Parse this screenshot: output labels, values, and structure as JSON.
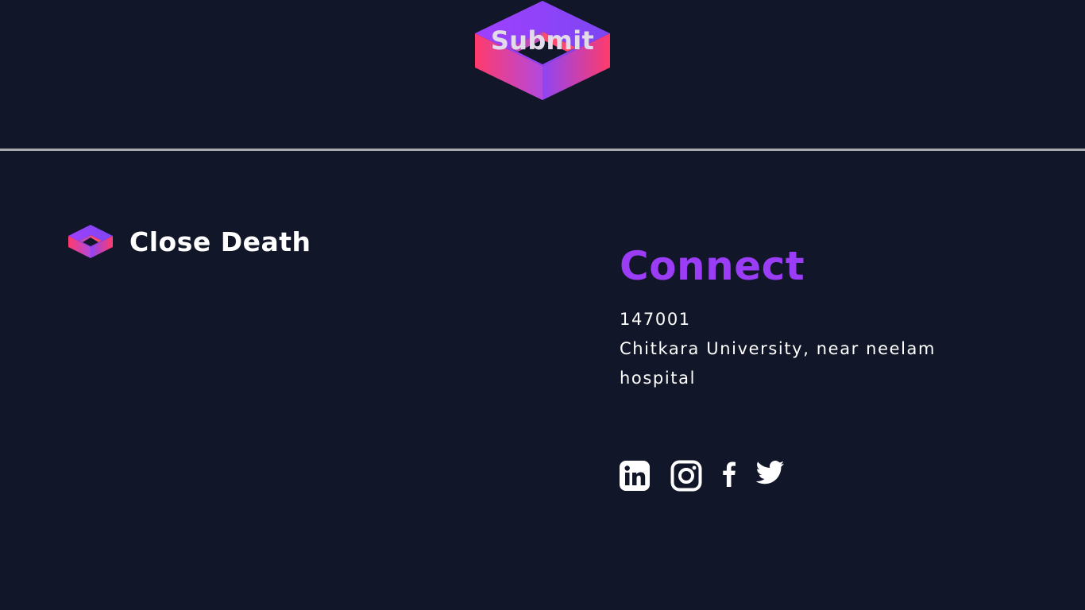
{
  "submit": {
    "label": "Submit"
  },
  "brand": {
    "name": "Close Death",
    "logo_icon": "isometric-cube-logo-icon"
  },
  "connect": {
    "title": "Connect",
    "postal_code": "147001",
    "address": "Chitkara University, near neelam hospital"
  },
  "socials": [
    {
      "name": "LinkedIn",
      "icon": "linkedin-icon"
    },
    {
      "name": "Instagram",
      "icon": "instagram-icon"
    },
    {
      "name": "Facebook",
      "icon": "facebook-icon"
    },
    {
      "name": "Twitter",
      "icon": "twitter-icon"
    }
  ],
  "colors": {
    "background": "#111628",
    "accent_purple": "#9b3cf6",
    "gradient_pink": "#ff3b6b",
    "gradient_violet": "#a040ff",
    "divider": "#a9a8ae",
    "text": "#ffffff"
  }
}
